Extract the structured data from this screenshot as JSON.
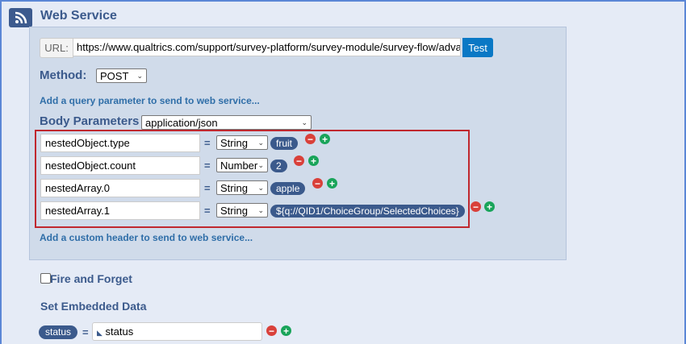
{
  "title": "Web Service",
  "url": {
    "label": "URL:",
    "value": "https://www.qualtrics.com/support/survey-platform/survey-module/survey-flow/advanced",
    "test_label": "Test"
  },
  "method": {
    "label": "Method:",
    "value": "POST"
  },
  "add_query_link": "Add a query parameter to send to web service...",
  "body": {
    "label": "Body Parameters",
    "content_type": "application/json",
    "params": [
      {
        "key": "nestedObject.type",
        "type": "String",
        "value": "fruit"
      },
      {
        "key": "nestedObject.count",
        "type": "Number",
        "value": "2"
      },
      {
        "key": "nestedArray.0",
        "type": "String",
        "value": "apple"
      },
      {
        "key": "nestedArray.1",
        "type": "String",
        "value": "${q://QID1/ChoiceGroup/SelectedChoices}"
      }
    ],
    "equals": "="
  },
  "add_header_link": "Add a custom header to send to web service...",
  "fire_and_forget": {
    "label": "Fire and Forget",
    "checked": false
  },
  "embedded": {
    "label": "Set Embedded Data",
    "rows": [
      {
        "field": "status",
        "value": "status"
      }
    ]
  }
}
